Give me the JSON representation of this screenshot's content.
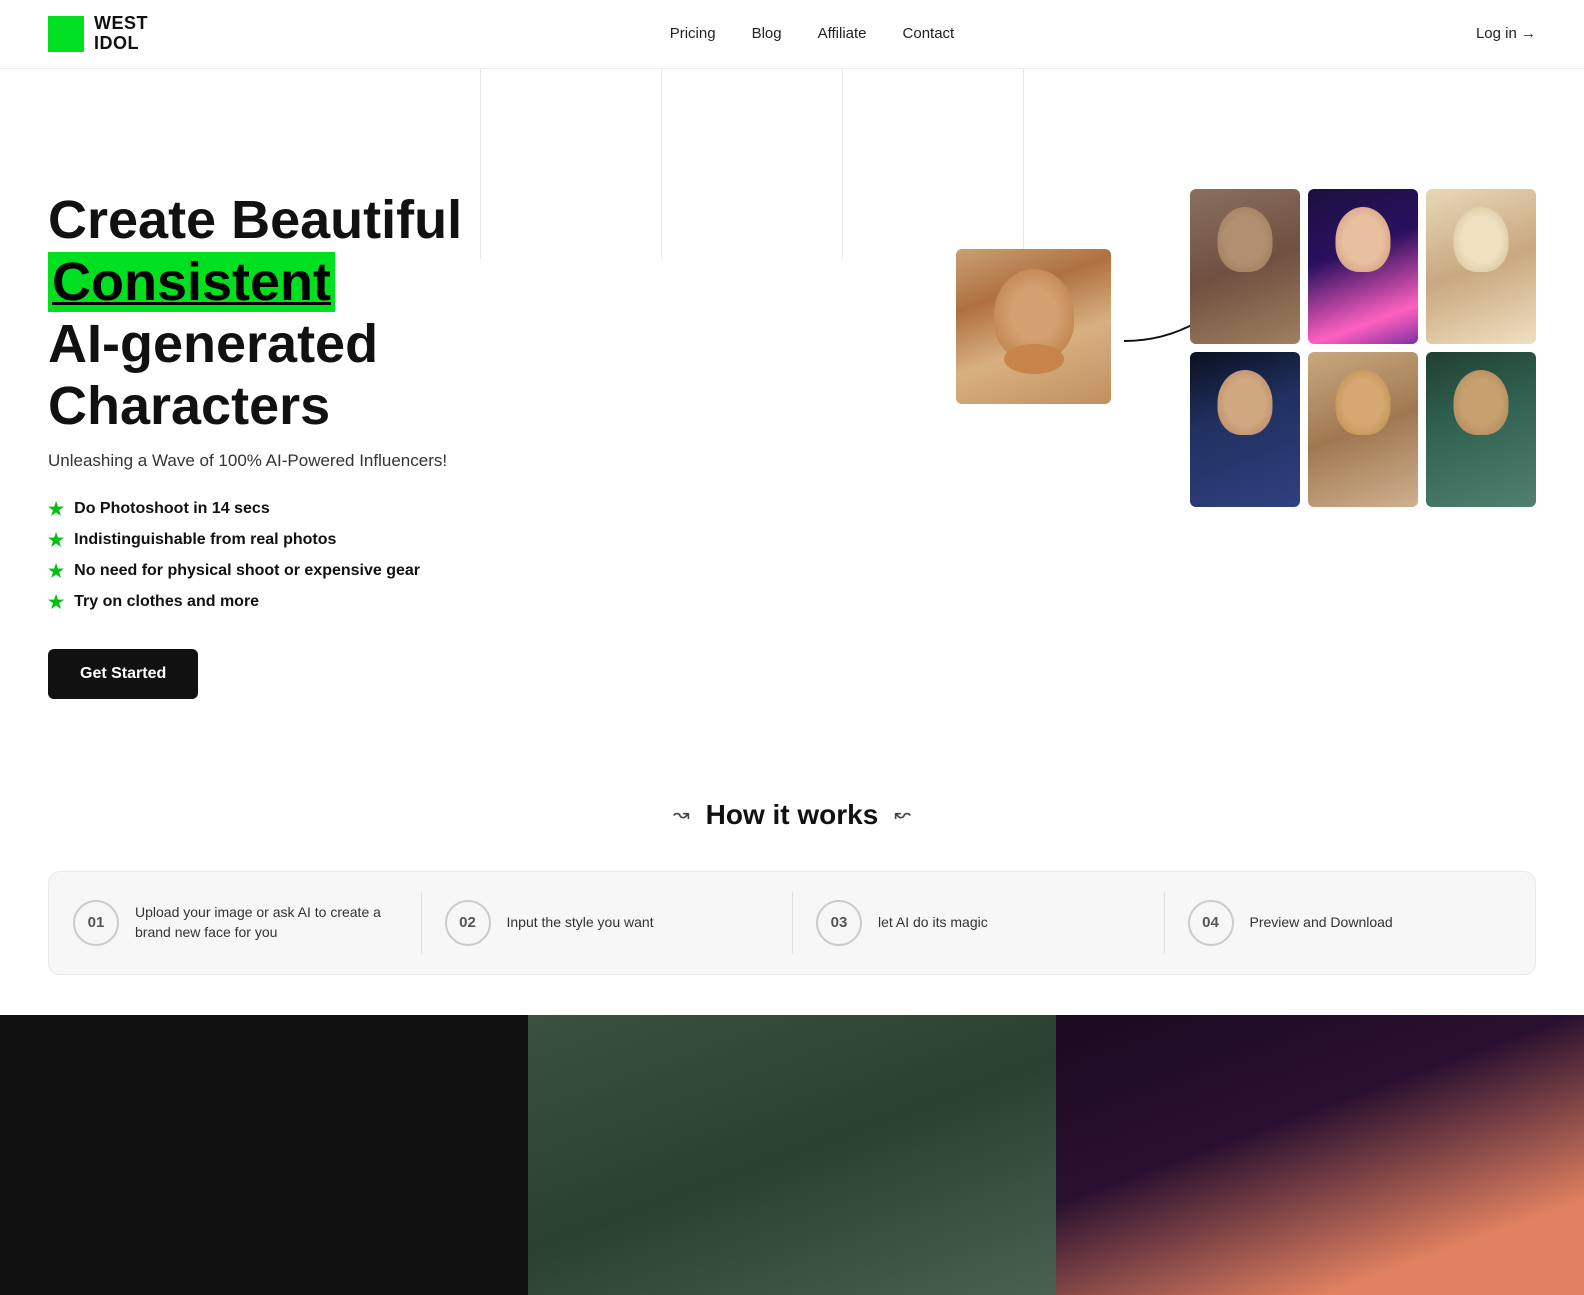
{
  "brand": {
    "logo_text": "WEST\nIDOL",
    "logo_line1": "WEST",
    "logo_line2": "IDOL"
  },
  "nav": {
    "links": [
      {
        "label": "Pricing",
        "id": "pricing"
      },
      {
        "label": "Blog",
        "id": "blog"
      },
      {
        "label": "Affiliate",
        "id": "affiliate"
      },
      {
        "label": "Contact",
        "id": "contact"
      }
    ],
    "login_label": "Log in →"
  },
  "hero": {
    "title_part1": "Create Beautiful ",
    "title_highlight": "Consistent",
    "title_part2": "AI-generated Characters",
    "subtitle": "Unleashing a Wave of 100% AI-Powered Influencers!",
    "features": [
      "Do Photoshoot in 14 secs",
      "Indistinguishable from real photos",
      "No need for physical shoot or expensive gear",
      "Try on clothes and more"
    ],
    "cta_label": "Get Started"
  },
  "how_it_works": {
    "title": "How it works",
    "deco_left": "↝",
    "deco_right": "↜",
    "steps": [
      {
        "num": "01",
        "label": "Upload your image or ask AI to create a brand new face for you"
      },
      {
        "num": "02",
        "label": "Input the style you want"
      },
      {
        "num": "03",
        "label": "let AI do its magic"
      },
      {
        "num": "04",
        "label": "Preview and Download"
      }
    ]
  },
  "colors": {
    "green_accent": "#00e020",
    "dark": "#111111"
  }
}
